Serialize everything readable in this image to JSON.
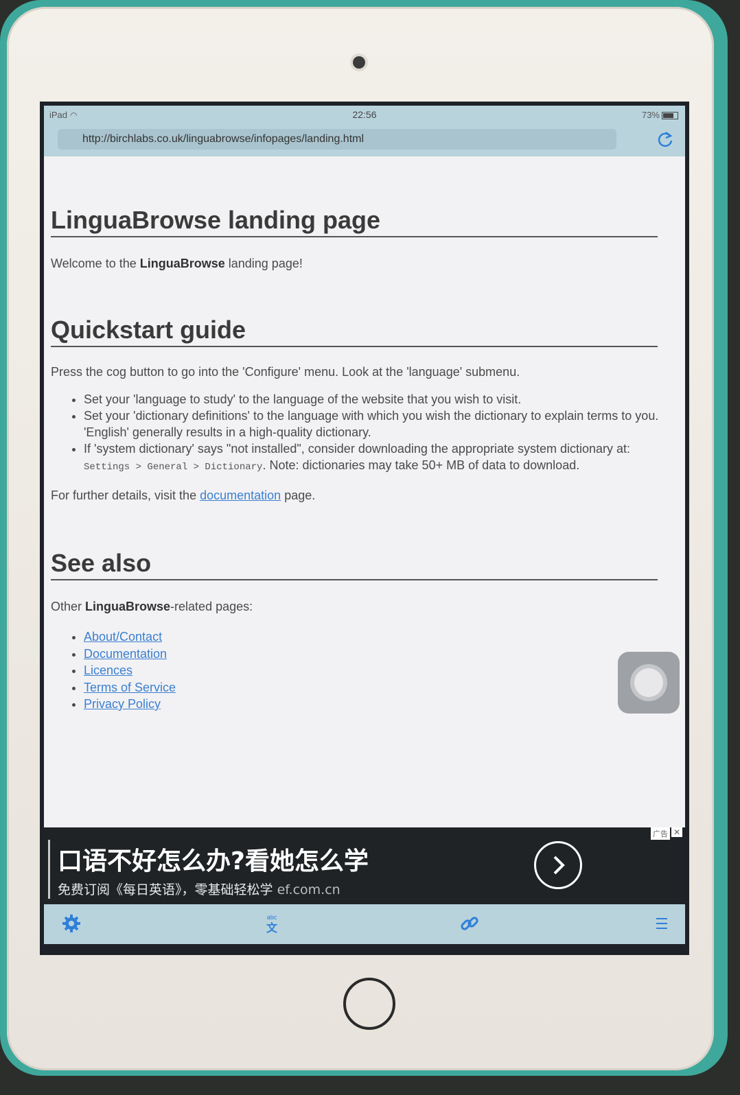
{
  "status_bar": {
    "device": "iPad",
    "time": "22:56",
    "battery": "73%"
  },
  "browser": {
    "url": "http://birchlabs.co.uk/linguabrowse/infopages/landing.html"
  },
  "page": {
    "title": "LinguaBrowse landing page",
    "welcome_prefix": "Welcome to the ",
    "welcome_brand": "LinguaBrowse",
    "welcome_suffix": " landing page!",
    "quickstart": {
      "heading": "Quickstart guide",
      "intro": "Press the cog button to go into the 'Configure' menu. Look at the 'language' submenu.",
      "bullets": [
        "Set your 'language to study' to the language of the website that you wish to visit.",
        "Set your 'dictionary definitions' to the language with which you wish the dictionary to explain terms to you. 'English' generally results in a high-quality dictionary."
      ],
      "bullet3_prefix": "If 'system dictionary' says \"not installed\", consider downloading the appropriate system dictionary at: ",
      "bullet3_code": "Settings > General > Dictionary",
      "bullet3_suffix": ". Note: dictionaries may take 50+ MB of data to download.",
      "further_prefix": "For further details, visit the ",
      "further_link": "documentation",
      "further_suffix": " page."
    },
    "see_also": {
      "heading": "See also",
      "intro_prefix": "Other ",
      "intro_brand": "LinguaBrowse",
      "intro_suffix": "-related pages:",
      "links": [
        "About/Contact",
        "Documentation",
        "Licences",
        "Terms of Service",
        "Privacy Policy"
      ]
    }
  },
  "ad": {
    "headline": "口语不好怎么办?看她怎么学",
    "subline": "免费订阅《每日英语》，零基础轻松学",
    "domain": "ef.com.cn",
    "badge": "广告"
  },
  "toolbar": {
    "icons": [
      "gear-icon",
      "translate-icon",
      "link-icon",
      "menu-icon"
    ],
    "accent": "#2f80d8"
  }
}
